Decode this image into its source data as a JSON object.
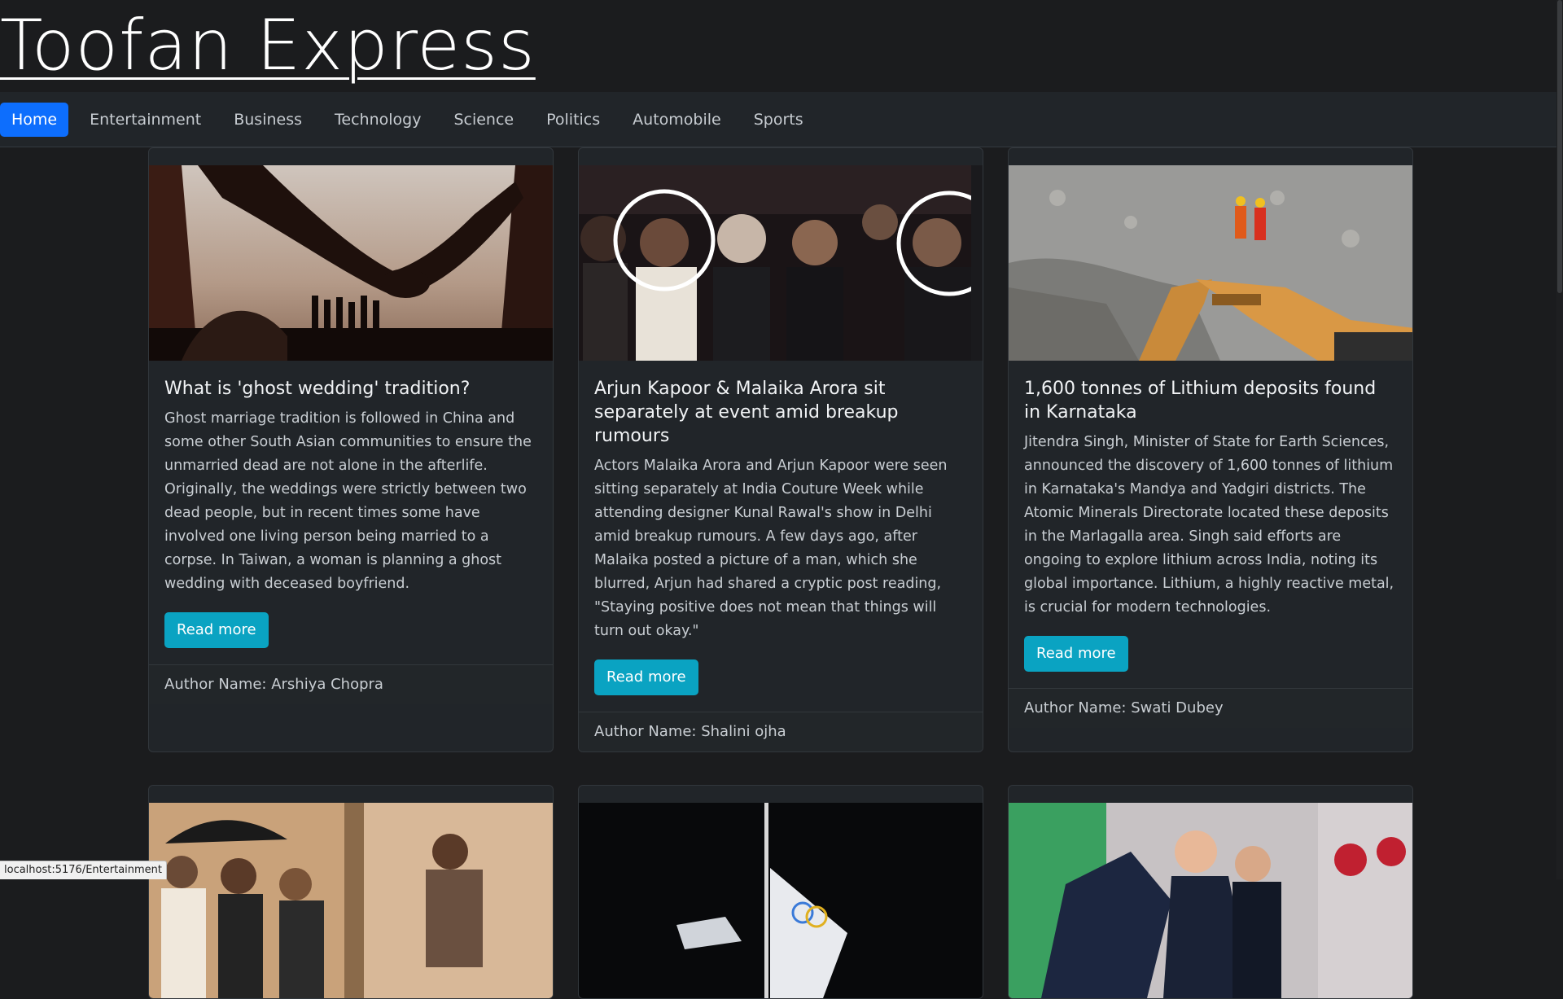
{
  "site": {
    "title": "Toofan Express"
  },
  "nav": {
    "items": [
      "Home",
      "Entertainment",
      "Business",
      "Technology",
      "Science",
      "Politics",
      "Automobile",
      "Sports"
    ],
    "active": "Home"
  },
  "articles": [
    {
      "title": "What is 'ghost wedding' tradition?",
      "description": "Ghost marriage tradition is followed in China and some other South Asian communities to ensure the unmarried dead are not alone in the afterlife. Originally, the weddings were strictly between two dead people, but in recent times some have involved one living person being married to a corpse. In Taiwan, a woman is planning a ghost wedding with deceased boyfriend.",
      "button": "Read more",
      "author": "Author Name: Arshiya Chopra"
    },
    {
      "title": "Arjun Kapoor & Malaika Arora sit separately at event amid breakup rumours",
      "description": "Actors Malaika Arora and Arjun Kapoor were seen sitting separately at India Couture Week while attending designer Kunal Rawal's show in Delhi amid breakup rumours. A few days ago, after Malaika posted a picture of a man, which she blurred, Arjun had shared a cryptic post reading, \"Staying positive does not mean that things will turn out okay.\"",
      "button": "Read more",
      "author": "Author Name: Shalini ojha"
    },
    {
      "title": "1,600 tonnes of Lithium deposits found in Karnataka",
      "description": "Jitendra Singh, Minister of State for Earth Sciences, announced the discovery of 1,600 tonnes of lithium in Karnataka's Mandya and Yadgiri districts. The Atomic Minerals Directorate located these deposits in the Marlagalla area. Singh said efforts are ongoing to explore lithium across India, noting its global importance. Lithium, a highly reactive metal, is crucial for modern technologies.",
      "button": "Read more",
      "author": "Author Name: Swati Dubey"
    }
  ],
  "status_bar": {
    "url": "localhost:5176/Entertainment"
  },
  "colors": {
    "accent": "#0d6efd",
    "button": "#0aa3c2",
    "background": "#1b1c1e",
    "card": "#212529"
  }
}
